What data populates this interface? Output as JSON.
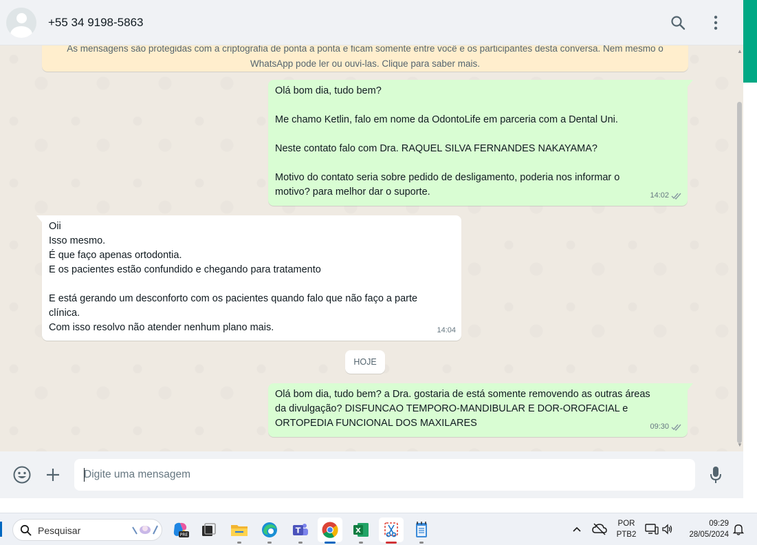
{
  "header": {
    "contact_name": "+55 34 9198-5863"
  },
  "encryption_notice": {
    "line1": "As mensagens são protegidas com a criptografia de ponta a ponta e ficam somente entre você e os participantes desta conversa. Nem mesmo o",
    "line2": "WhatsApp pode ler ou ouvi-las. Clique para saber mais."
  },
  "messages": [
    {
      "direction": "out",
      "lines": [
        "Olá bom dia, tudo bem?",
        "",
        "Me chamo Ketlin, falo em nome da OdontoLife em parceria com a Dental Uni.",
        "",
        "Neste contato falo com Dra. RAQUEL SILVA FERNANDES NAKAYAMA?",
        "",
        "Motivo do contato seria sobre pedido de desligamento, poderia nos informar o",
        "motivo? para melhor dar o suporte."
      ],
      "time": "14:02",
      "status": "read"
    },
    {
      "direction": "in",
      "lines": [
        "Oii",
        "Isso mesmo.",
        "É que faço apenas ortodontia.",
        "E os pacientes estão confundido e chegando para tratamento",
        "",
        "E está gerando um desconforto com os pacientes quando falo que não faço a parte",
        "clínica.",
        "Com isso resolvo não atender nenhum plano mais."
      ],
      "time": "14:04"
    },
    {
      "direction": "out",
      "lines": [
        "Olá bom dia, tudo bem? a Dra. gostaria de está somente removendo as outras áreas",
        "da divulgação? DISFUNCAO TEMPORO-MANDIBULAR E DOR-OROFACIAL e",
        "ORTOPEDIA FUNCIONAL DOS MAXILARES"
      ],
      "time": "09:30",
      "status": "read"
    }
  ],
  "day_divider": "HOJE",
  "composer": {
    "placeholder": "Digite uma mensagem"
  },
  "taskbar": {
    "search_label": "Pesquisar",
    "language": "POR",
    "layout": "PTB2",
    "time": "09:29",
    "date": "28/05/2024"
  },
  "colors": {
    "accent": "#00a884",
    "outgoing_bubble": "#d9fdd3",
    "incoming_bubble": "#ffffff",
    "read_ticks": "#8696a0"
  }
}
